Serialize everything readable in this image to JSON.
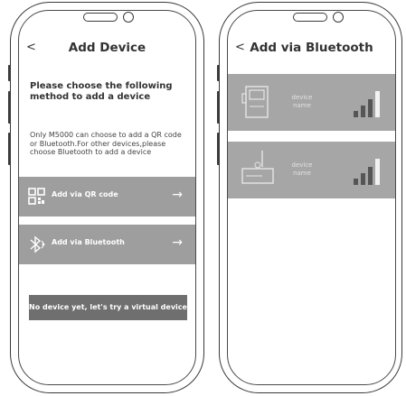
{
  "screen1": {
    "back_label": "<",
    "title": "Add Device",
    "heading": "Please choose the following method to add a device",
    "description": "Only M5000 can choose to add a QR code or Bluetooth.For other devices,please choose Bluetooth to add a device",
    "methods": [
      {
        "label": "Add via QR code",
        "icon": "qr-code-icon",
        "arrow": "→"
      },
      {
        "label": "Add via Bluetooth",
        "icon": "bluetooth-icon",
        "arrow": "→"
      }
    ],
    "virtual_button_label": "No device yet, let's try a virtual device first"
  },
  "screen2": {
    "back_label": "<",
    "title": "Add via Bluetooth",
    "devices": [
      {
        "name": "device\nname",
        "icon": "device-icon",
        "signal_icon": "signal-strength-icon"
      },
      {
        "name": "device\nname",
        "icon": "router-icon",
        "signal_icon": "signal-strength-icon"
      }
    ]
  },
  "colors": {
    "method_bg": "#9e9e9e",
    "virtual_bg": "#6f6f6f",
    "device_bg": "#a6a6a6",
    "text": "#333333"
  }
}
